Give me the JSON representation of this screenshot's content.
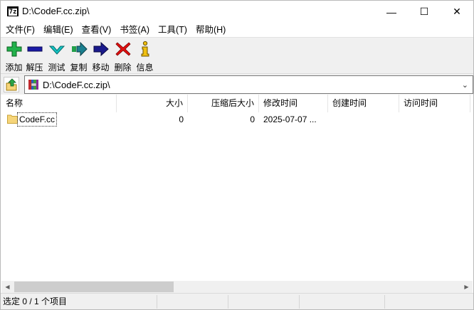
{
  "window": {
    "title": "D:\\CodeF.cc.zip\\",
    "app_icon_text": "7z",
    "buttons": {
      "minimize": "—",
      "maximize": "☐",
      "close": "✕"
    }
  },
  "menu": [
    "文件(F)",
    "编辑(E)",
    "查看(V)",
    "书签(A)",
    "工具(T)",
    "帮助(H)"
  ],
  "toolbar": {
    "add": "添加",
    "extract": "解压",
    "test": "测试",
    "copy": "复制",
    "move": "移动",
    "delete": "删除",
    "info": "信息"
  },
  "address": {
    "path": "D:\\CodeF.cc.zip\\"
  },
  "columns": {
    "name": "名称",
    "size": "大小",
    "packed": "压缩后大小",
    "modified": "修改时间",
    "created": "创建时间",
    "accessed": "访问时间"
  },
  "rows": [
    {
      "name": "CodeF.cc",
      "size": "0",
      "packed": "0",
      "modified": "2025-07-07 ..."
    }
  ],
  "status": {
    "selection": "选定 0 / 1 个项目"
  },
  "colors": {
    "add": "#22b14c",
    "extract": "#1a1aa6",
    "test": "#12c4c4",
    "move": "#1a1a8c",
    "delete": "#e01010",
    "info": "#f0c010",
    "folder": "#f6d57a"
  }
}
